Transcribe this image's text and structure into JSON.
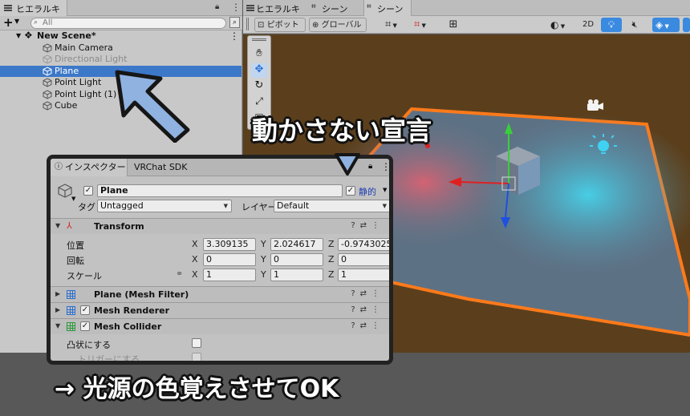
{
  "hierarchy": {
    "tab_label": "ヒエラルキー",
    "add_label": "+",
    "search_placeholder": "All",
    "items": [
      {
        "label": "New Scene*"
      },
      {
        "label": "Main Camera"
      },
      {
        "label": "Directional Light"
      },
      {
        "label": "Plane"
      },
      {
        "label": "Point Light"
      },
      {
        "label": "Point Light (1)"
      },
      {
        "label": "Cube"
      }
    ]
  },
  "scene_view": {
    "tabs": [
      "ヒエラルキー",
      "シーン",
      "シーン"
    ],
    "toolbar": {
      "pivot_label": "ピボット",
      "global_label": "グローバル",
      "mode_2d_label": "2D"
    }
  },
  "inspector": {
    "tabs": [
      "インスペクター",
      "VRChat SDK"
    ],
    "object_name": "Plane",
    "active": true,
    "static_label": "静的",
    "static_checked": true,
    "tag_label": "タグ",
    "tag_value": "Untagged",
    "layer_label": "レイヤー",
    "layer_value": "Default",
    "transform": {
      "title": "Transform",
      "position_label": "位置",
      "rotation_label": "回転",
      "scale_label": "スケール",
      "axes": [
        "X",
        "Y",
        "Z"
      ],
      "position": [
        "3.309135",
        "2.024617",
        "-0.9743025"
      ],
      "rotation": [
        "0",
        "0",
        "0"
      ],
      "scale": [
        "1",
        "1",
        "1"
      ]
    },
    "components": [
      {
        "title": "Plane (Mesh Filter)",
        "has_checkbox": false
      },
      {
        "title": "Mesh Renderer",
        "has_checkbox": true
      },
      {
        "title": "Mesh Collider",
        "has_checkbox": true
      }
    ],
    "convex_label": "凸状にする",
    "trigger_label": "トリガーにする"
  },
  "annotations": {
    "top_callout": "動かさない宣言",
    "bottom_callout": "→ 光源の色覚えさせてOK"
  },
  "colors": {
    "selection": "#3c78c8",
    "plane_outline": "#ff7a1a",
    "callout_arrow": "#8fb2e0",
    "light_icon": "#3fd2f2"
  }
}
